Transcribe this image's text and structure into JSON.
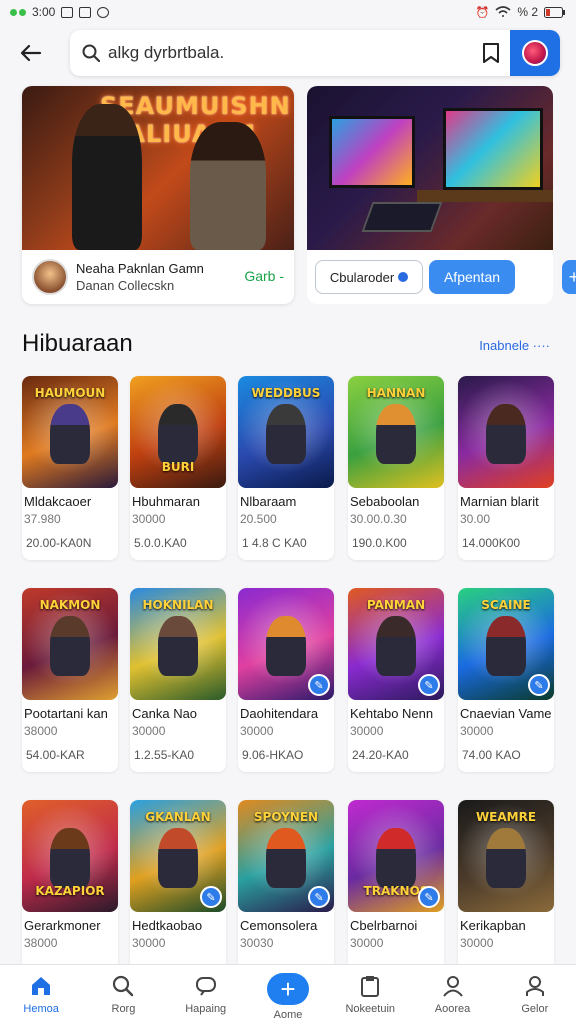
{
  "status": {
    "time": "3:00",
    "battery": "% 2"
  },
  "search": {
    "value": "alkg dyrbrtbala."
  },
  "banners": [
    {
      "sign": "SEAUMUISHN WALIUAAM",
      "title": "Neaha Paknlan Gamn",
      "subtitle": "Danan Collecskn",
      "cta": "Garb -"
    },
    {
      "outline_button": "Cbularoder",
      "primary_button": "Afpentan",
      "plus": "+"
    }
  ],
  "section": {
    "title": "Hibuaraan",
    "see_all": "Inabnele ····"
  },
  "cards": [
    {
      "name": "Mldakcaoer",
      "sub": "37.980",
      "price": "20.00-KA0N",
      "logo": "HAUMOUN",
      "colors": [
        "#6a2a10",
        "#e07a20",
        "#2a1a3a"
      ],
      "hero": "#4a3a8a"
    },
    {
      "name": "Hbuhmaran",
      "sub": "30000",
      "price": "5.0.0.KA0",
      "logo": "BURI",
      "colors": [
        "#f0a020",
        "#c04010",
        "#3a1a10"
      ],
      "hero": "#2a2a2a"
    },
    {
      "name": "Nlbaraam",
      "sub": "20.500",
      "price": "1 4.8 C KA0",
      "logo": "WEDDBUS",
      "colors": [
        "#1a8ae0",
        "#2a4ab0",
        "#0a1a4a"
      ],
      "hero": "#3a3a3a"
    },
    {
      "name": "Sebaboolan",
      "sub": "30.00.0.30",
      "price": "190.0.K00",
      "logo": "HANNAN",
      "colors": [
        "#8ad040",
        "#3aa040",
        "#e0c020"
      ],
      "hero": "#e09030"
    },
    {
      "name": "Marnian blarit",
      "sub": "30.00",
      "price": "14.000K00",
      "logo": "",
      "colors": [
        "#2a1a4a",
        "#8a2aa0",
        "#e04020"
      ],
      "hero": "#4a2a20"
    },
    {
      "name": "Pootartani kan",
      "sub": "38000",
      "price": "54.00-KAR",
      "logo": "NAKMON",
      "colors": [
        "#c03a2a",
        "#6a1a3a",
        "#e0a030"
      ],
      "hero": "#5a3a2a"
    },
    {
      "name": "Canka Nao",
      "sub": "30000",
      "price": "1.2.55-KA0",
      "logo": "HOKNILAN",
      "colors": [
        "#2a8ae0",
        "#e0c030",
        "#2a5a2a"
      ],
      "hero": "#6a4a3a"
    },
    {
      "name": "Daohitendara",
      "sub": "30000",
      "price": "9.06-HKAO",
      "logo": "",
      "colors": [
        "#8a2ad0",
        "#e040a0",
        "#2a1a6a"
      ],
      "hero": "#e08a30",
      "badge": true
    },
    {
      "name": "Kehtabo Nenn",
      "sub": "30000",
      "price": "24.20-KA0",
      "logo": "PANMAN",
      "colors": [
        "#e05a20",
        "#8a2ad0",
        "#2a1a5a"
      ],
      "hero": "#3a2a2a",
      "badge": true
    },
    {
      "name": "Cnaevian Vame",
      "sub": "30000",
      "price": "74.00 KAO",
      "logo": "SCAINE",
      "colors": [
        "#2ad080",
        "#1a6ae0",
        "#0a3a2a"
      ],
      "hero": "#8a2a2a",
      "badge": true
    },
    {
      "name": "Gerarkmoner",
      "sub": "38000",
      "price": "",
      "logo": "KAZAPIOR",
      "colors": [
        "#e0602a",
        "#c02a4a",
        "#2a1a2a"
      ],
      "hero": "#6a3a1a"
    },
    {
      "name": "Hedtkaobao",
      "sub": "30000",
      "price": "",
      "logo": "GKANLAN",
      "colors": [
        "#2aa0e0",
        "#e0a020",
        "#1a4a2a"
      ],
      "hero": "#c04a2a",
      "badge": true
    },
    {
      "name": "Cemonsolera",
      "sub": "30030",
      "price": "",
      "logo": "SPOYNEN",
      "colors": [
        "#e08a20",
        "#2aa0a0",
        "#2a1a4a"
      ],
      "hero": "#e05a20",
      "badge": true
    },
    {
      "name": "Cbelrbarnoi",
      "sub": "30000",
      "price": "",
      "logo": "TRAKNOS",
      "colors": [
        "#c02ad0",
        "#6a2aa0",
        "#e0a020"
      ],
      "hero": "#d02a2a",
      "badge": true
    },
    {
      "name": "Kerikapban",
      "sub": "30000",
      "price": "",
      "logo": "WEAMRE",
      "colors": [
        "#1a1a1a",
        "#4a3a2a",
        "#8a6a3a"
      ],
      "hero": "#a07a3a"
    }
  ],
  "nav": [
    {
      "label": "Hemoa",
      "icon": "home-icon",
      "active": true
    },
    {
      "label": "Rorg",
      "icon": "search-icon"
    },
    {
      "label": "Hapaing",
      "icon": "chat-icon"
    },
    {
      "label": "Aome",
      "icon": "plus-icon",
      "fab": true
    },
    {
      "label": "Nokeetuin",
      "icon": "clipboard-icon"
    },
    {
      "label": "Aoorea",
      "icon": "profile-icon"
    },
    {
      "label": "Gelor",
      "icon": "user-icon"
    }
  ]
}
